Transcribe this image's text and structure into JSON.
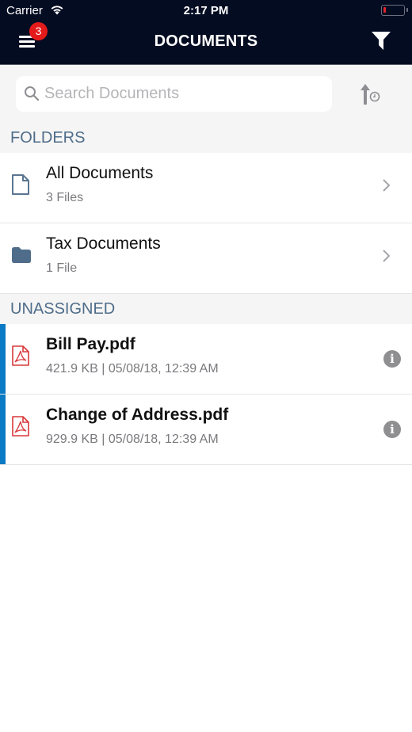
{
  "status_bar": {
    "carrier": "Carrier",
    "time": "2:17 PM",
    "battery_level": 0.1
  },
  "nav": {
    "title": "DOCUMENTS",
    "menu_badge": "3",
    "menu_icon": "hamburger-menu-icon",
    "filter_icon": "filter-funnel-icon"
  },
  "search": {
    "placeholder": "Search Documents",
    "value": "",
    "sort_icon": "sort-by-date-icon"
  },
  "sections": {
    "folders": {
      "header": "FOLDERS",
      "items": [
        {
          "name": "All Documents",
          "count": "3 Files",
          "icon": "document-outline-icon"
        },
        {
          "name": "Tax Documents",
          "count": "1 File",
          "icon": "folder-icon"
        }
      ]
    },
    "unassigned": {
      "header": "UNASSIGNED",
      "items": [
        {
          "name": "Bill Pay.pdf",
          "meta": "421.9 KB | 05/08/18, 12:39 AM",
          "icon": "pdf-file-icon"
        },
        {
          "name": "Change of Address.pdf",
          "meta": "929.9 KB | 05/08/18, 12:39 AM",
          "icon": "pdf-file-icon"
        }
      ]
    }
  },
  "colors": {
    "nav_background": "#040c22",
    "section_header_text": "#4f6d8a",
    "file_accent": "#0a7ac4",
    "badge": "#e51b1b",
    "pdf_icon": "#d9383a",
    "folder_icon": "#4f6d8a"
  }
}
